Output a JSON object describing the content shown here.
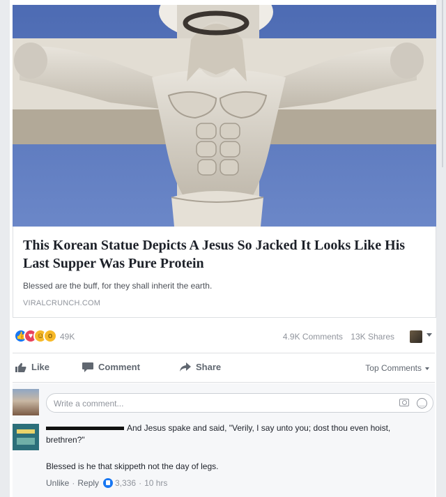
{
  "post": {
    "headline": "This Korean Statue Depicts A Jesus So Jacked It Looks Like His Last Supper Was Pure Protein",
    "description": "Blessed are the buff, for they shall inherit the earth.",
    "domain": "VIRALCRUNCH.COM"
  },
  "stats": {
    "reactions_count": "49K",
    "comments": "4.9K Comments",
    "shares": "13K Shares",
    "reaction_icons": [
      "like-icon",
      "love-icon",
      "laugh-icon",
      "wow-icon"
    ]
  },
  "actions": {
    "like": "Like",
    "comment": "Comment",
    "share": "Share",
    "sort": "Top Comments"
  },
  "comment_input": {
    "placeholder": "Write a comment..."
  },
  "comment": {
    "text": "And Jesus spake and said, \"Verily, I say unto you; dost thou even hoist, brethren?\"",
    "reply_text": "Blessed is he that skippeth not the day of legs.",
    "unlike": "Unlike",
    "reply": "Reply",
    "likes": "3,336",
    "time": "10 hrs"
  },
  "colors": {
    "accent": "#1877f2",
    "sky": "#4f6fb5"
  }
}
